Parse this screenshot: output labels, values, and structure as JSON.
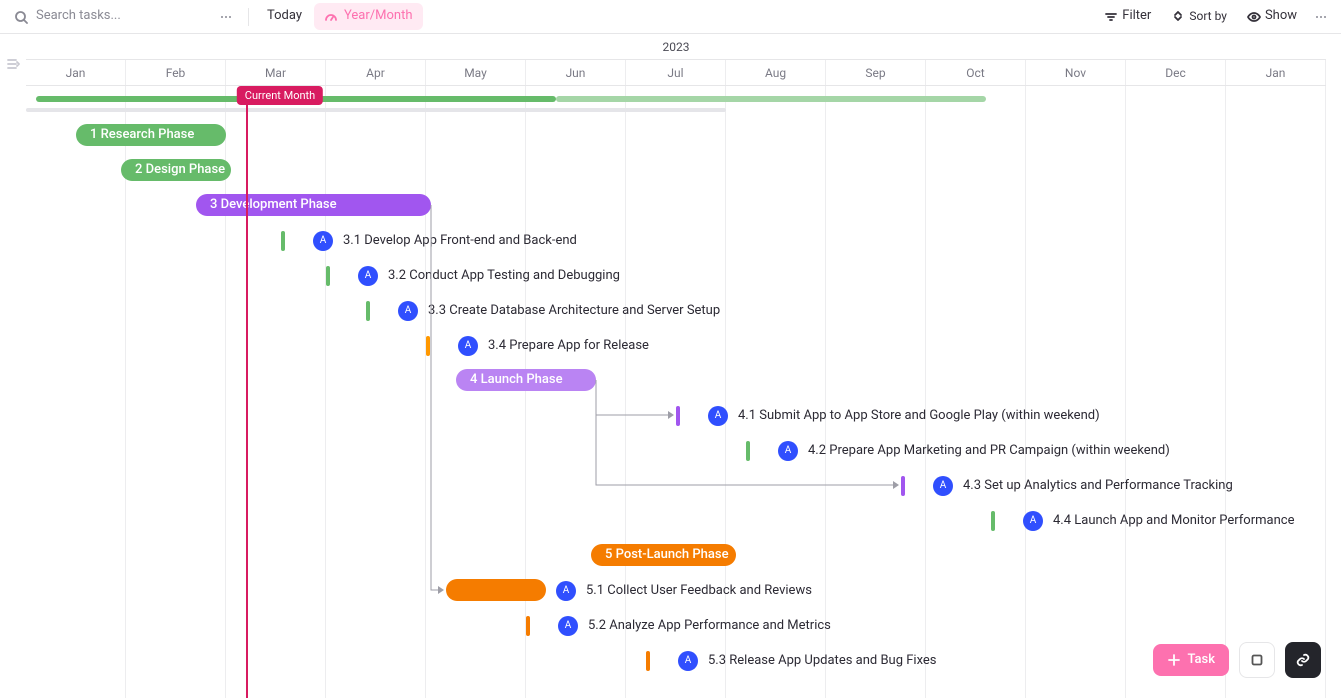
{
  "toolbar": {
    "search_placeholder": "Search tasks...",
    "today": "Today",
    "granularity": "Year/Month",
    "filter": "Filter",
    "sort": "Sort by",
    "show": "Show"
  },
  "timeline": {
    "year": "2023",
    "months": [
      "Jan",
      "Feb",
      "Mar",
      "Apr",
      "May",
      "Jun",
      "Jul",
      "Aug",
      "Sep",
      "Oct",
      "Nov",
      "Dec",
      "Jan"
    ],
    "current_month_label": "Current Month",
    "current_month_pos": 2.2
  },
  "summaries": [
    {
      "start": 0.1,
      "end": 5.3,
      "color": "#66bb6a"
    },
    {
      "start": 5.3,
      "end": 9.6,
      "color": "#a5d6a7"
    }
  ],
  "shadow": {
    "end": 7.0
  },
  "rows": [
    {
      "kind": "bar",
      "start": 0.5,
      "end": 2.0,
      "color": "#66bb6a",
      "label": "1 Research Phase"
    },
    {
      "kind": "bar",
      "start": 0.95,
      "end": 2.05,
      "color": "#66bb6a",
      "label": "2 Design Phase"
    },
    {
      "kind": "bar",
      "start": 1.7,
      "end": 4.05,
      "color": "#a156ef",
      "label": "3 Development Phase"
    },
    {
      "kind": "sub",
      "tick_at": 2.55,
      "tick_color": "#66bb6a",
      "label": "3.1 Develop App Front-end and Back-end",
      "av": "A"
    },
    {
      "kind": "sub",
      "tick_at": 3.0,
      "tick_color": "#66bb6a",
      "label": "3.2 Conduct App Testing and Debugging",
      "av": "A"
    },
    {
      "kind": "sub",
      "tick_at": 3.4,
      "tick_color": "#66bb6a",
      "label": "3.3 Create Database Architecture and Server Setup",
      "av": "A"
    },
    {
      "kind": "sub",
      "tick_at": 4.0,
      "tick_color": "#ff9800",
      "label": "3.4 Prepare App for Release",
      "av": "A"
    },
    {
      "kind": "bar",
      "start": 4.3,
      "end": 5.7,
      "color": "#ba84f3",
      "label": "4 Launch Phase"
    },
    {
      "kind": "sub",
      "tick_at": 6.5,
      "tick_color": "#a156ef",
      "label": "4.1 Submit App to App Store and Google Play (within weekend)",
      "av": "A"
    },
    {
      "kind": "sub",
      "tick_at": 7.2,
      "tick_color": "#66bb6a",
      "label": "4.2 Prepare App Marketing and PR Campaign (within weekend)",
      "av": "A"
    },
    {
      "kind": "sub",
      "tick_at": 8.75,
      "tick_color": "#a156ef",
      "label": "4.3 Set up Analytics and Performance Tracking",
      "av": "A"
    },
    {
      "kind": "sub",
      "tick_at": 9.65,
      "tick_color": "#66bb6a",
      "label": "4.4 Launch App and Monitor Performance",
      "av": "A"
    },
    {
      "kind": "bar",
      "start": 5.65,
      "end": 7.1,
      "color": "#f57c00",
      "label": "5 Post-Launch Phase"
    },
    {
      "kind": "bar-mute",
      "start": 4.2,
      "end": 5.2,
      "color": "#f57c00",
      "label": "",
      "sub_label": "5.1 Collect User Feedback and Reviews",
      "av": "A"
    },
    {
      "kind": "sub",
      "tick_at": 5.0,
      "tick_color": "#f57c00",
      "label": "5.2 Analyze App Performance and Metrics",
      "av": "A"
    },
    {
      "kind": "sub",
      "tick_at": 6.2,
      "tick_color": "#f57c00",
      "label": "5.3 Release App Updates and Bug Fixes",
      "av": "A"
    }
  ],
  "connectors": [
    {
      "fromX": 5.7,
      "fromRow": 7,
      "toX": 6.5,
      "toRow": 8,
      "kind": "down-right"
    },
    {
      "fromX": 5.7,
      "fromRow": 7,
      "toX": 8.75,
      "toRow": 10,
      "kind": "down-right"
    },
    {
      "fromX": 9.65,
      "fromRow": 11,
      "toX": 9.65,
      "toRow": 11,
      "kind": "short-down"
    },
    {
      "fromX": 4.05,
      "fromRow": 2,
      "toX": 4.2,
      "toRow": 13,
      "kind": "long-down-right"
    }
  ],
  "fab": {
    "task": "Task"
  }
}
